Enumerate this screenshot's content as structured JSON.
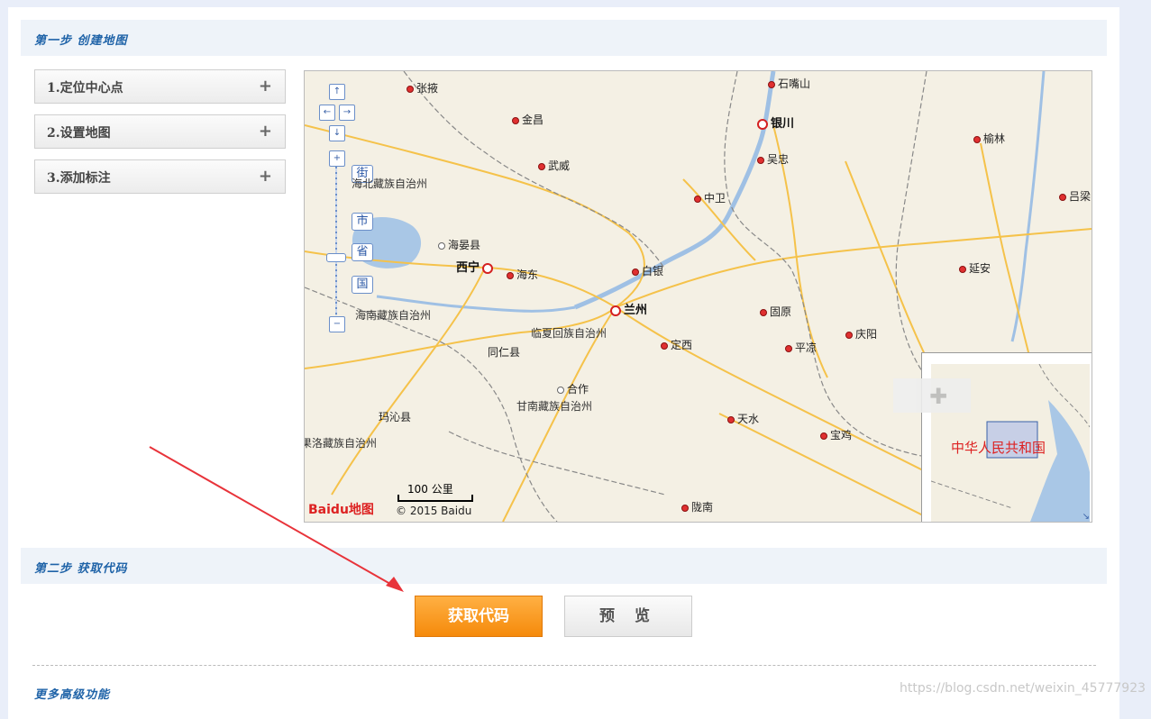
{
  "step1": {
    "title": "第一步 创建地图"
  },
  "accordion": [
    {
      "label": "1.定位中心点",
      "icon": "plus-icon"
    },
    {
      "label": "2.设置地图",
      "icon": "plus-icon"
    },
    {
      "label": "3.添加标注",
      "icon": "plus-icon"
    }
  ],
  "map": {
    "zoom_levels": [
      "街",
      "市",
      "省",
      "国"
    ],
    "zoom_in": "+",
    "zoom_out": "−",
    "cities": [
      {
        "name": "张掖",
        "type": "city"
      },
      {
        "name": "石嘴山",
        "type": "city"
      },
      {
        "name": "金昌",
        "type": "city"
      },
      {
        "name": "银川",
        "type": "capital"
      },
      {
        "name": "榆林",
        "type": "city"
      },
      {
        "name": "吴忠",
        "type": "city"
      },
      {
        "name": "武威",
        "type": "city"
      },
      {
        "name": "中卫",
        "type": "city"
      },
      {
        "name": "吕梁",
        "type": "city"
      },
      {
        "name": "海晏县",
        "type": "county"
      },
      {
        "name": "西宁",
        "type": "capital"
      },
      {
        "name": "海东",
        "type": "city"
      },
      {
        "name": "白银",
        "type": "city"
      },
      {
        "name": "延安",
        "type": "city"
      },
      {
        "name": "兰州",
        "type": "capital"
      },
      {
        "name": "固原",
        "type": "city"
      },
      {
        "name": "庆阳",
        "type": "city"
      },
      {
        "name": "定西",
        "type": "city"
      },
      {
        "name": "平凉",
        "type": "city"
      },
      {
        "name": "同仁县",
        "type": "county"
      },
      {
        "name": "合作",
        "type": "county"
      },
      {
        "name": "天水",
        "type": "city"
      },
      {
        "name": "宝鸡",
        "type": "city"
      },
      {
        "name": "玛沁县",
        "type": "county"
      },
      {
        "name": "陇南",
        "type": "city"
      }
    ],
    "regions": [
      "海北藏族自治州",
      "海南藏族自治州",
      "临夏回族自治州",
      "甘南藏族自治州",
      "果洛藏族自治州"
    ],
    "scale": "100 公里",
    "logo_text": "Baidu地图",
    "copyright": "© 2015 Baidu",
    "overview_label": "中华人民共和国"
  },
  "step2": {
    "title": "第二步 获取代码"
  },
  "buttons": {
    "get_code": "获取代码",
    "preview": "预 览"
  },
  "more": {
    "title": "更多高级功能"
  },
  "watermark": "https://blog.csdn.net/weixin_45777923"
}
